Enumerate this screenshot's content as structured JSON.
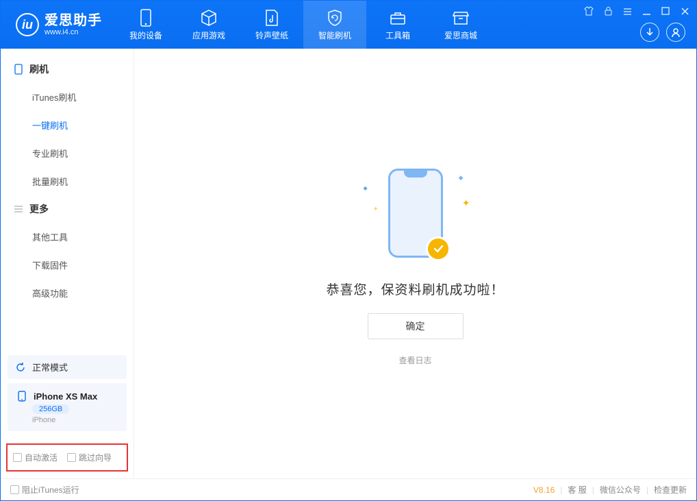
{
  "colors": {
    "primary": "#0a6ef0",
    "accent": "#f7b500",
    "highlight_border": "#e63434"
  },
  "app": {
    "name": "爱思助手",
    "site": "www.i4.cn"
  },
  "nav": {
    "tabs": [
      {
        "id": "device",
        "label": "我的设备"
      },
      {
        "id": "apps",
        "label": "应用游戏"
      },
      {
        "id": "ringtone",
        "label": "铃声壁纸"
      },
      {
        "id": "flash",
        "label": "智能刷机"
      },
      {
        "id": "toolbox",
        "label": "工具箱"
      },
      {
        "id": "store",
        "label": "爱思商城"
      }
    ],
    "active": "flash"
  },
  "sidebar": {
    "groups": [
      {
        "id": "flash",
        "title": "刷机",
        "items": [
          {
            "id": "itunes",
            "label": "iTunes刷机"
          },
          {
            "id": "onekey",
            "label": "一键刷机"
          },
          {
            "id": "pro",
            "label": "专业刷机"
          },
          {
            "id": "batch",
            "label": "批量刷机"
          }
        ]
      },
      {
        "id": "more",
        "title": "更多",
        "items": [
          {
            "id": "other",
            "label": "其他工具"
          },
          {
            "id": "firmware",
            "label": "下载固件"
          },
          {
            "id": "advanced",
            "label": "高级功能"
          }
        ]
      }
    ],
    "active": "onekey"
  },
  "device": {
    "mode_label": "正常模式",
    "name": "iPhone XS Max",
    "capacity": "256GB",
    "type": "iPhone"
  },
  "options": {
    "auto_activate_label": "自动激活",
    "skip_guide_label": "跳过向导"
  },
  "main": {
    "success_text": "恭喜您，保资料刷机成功啦！",
    "ok_label": "确定",
    "view_log_label": "查看日志"
  },
  "statusbar": {
    "block_itunes_label": "阻止iTunes运行",
    "version": "V8.16",
    "links": {
      "support": "客 服",
      "wechat": "微信公众号",
      "update": "检查更新"
    }
  }
}
